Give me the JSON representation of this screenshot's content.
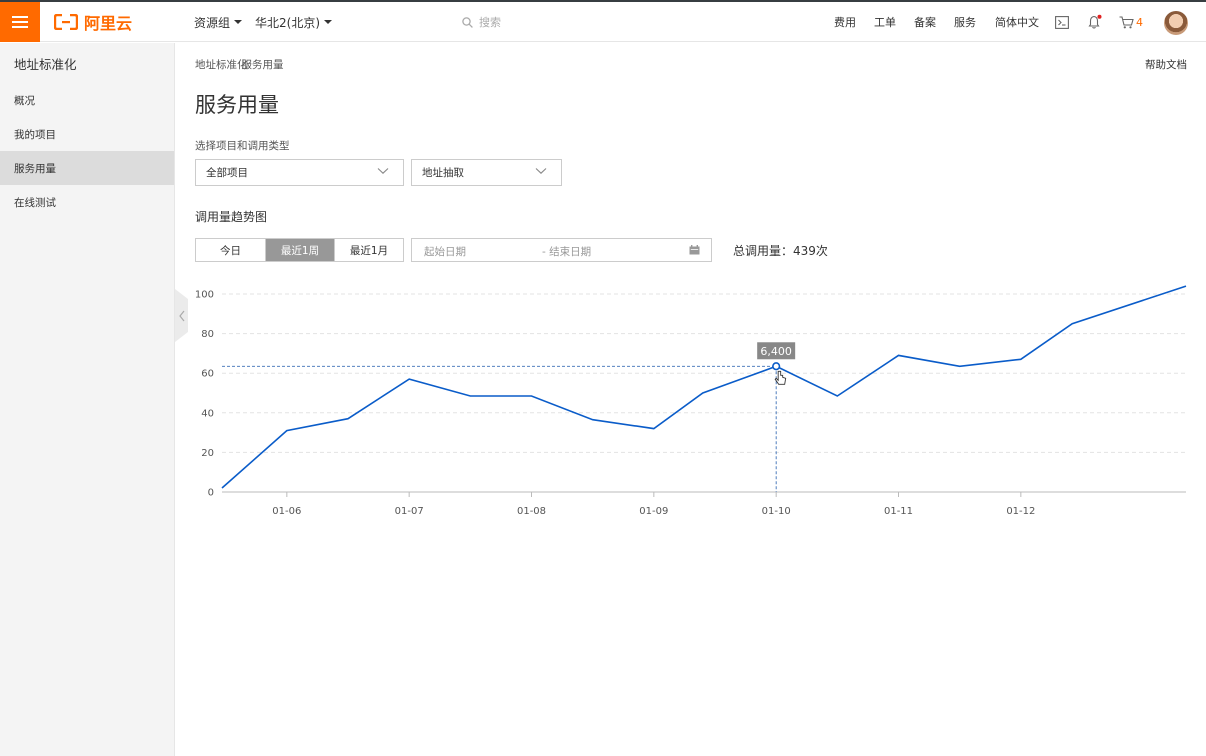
{
  "topbar": {
    "logo_text": "阿里云",
    "resource_group": "资源组",
    "region": "华北2(北京)",
    "search_placeholder": "搜索",
    "links": [
      "费用",
      "工单",
      "备案",
      "服务",
      "简体中文"
    ],
    "cart_count": "4"
  },
  "sidebar": {
    "title": "地址标准化",
    "items": [
      {
        "label": "概况",
        "active": false
      },
      {
        "label": "我的项目",
        "active": false
      },
      {
        "label": "服务用量",
        "active": true
      },
      {
        "label": "在线测试",
        "active": false
      }
    ]
  },
  "main": {
    "breadcrumb": "地址标准化",
    "breadcrumb_current": "服务用量",
    "help": "帮助文档",
    "title": "服务用量",
    "select_label": "选择项目和调用类型",
    "project_select": "全部项目",
    "type_select": "地址抽取",
    "section_title": "调用量趋势图",
    "ranges": [
      "今日",
      "最近1周",
      "最近1月"
    ],
    "active_range": 1,
    "date_start_placeholder": "起始日期",
    "date_end_placeholder": "- 结束日期",
    "total": "总调用量：439次"
  },
  "chart_data": {
    "type": "line",
    "x_ticks": [
      "01-06",
      "01-07",
      "01-08",
      "01-09",
      "01-10",
      "01-11",
      "01-12"
    ],
    "y_ticks": [
      0,
      20,
      40,
      60,
      80,
      100
    ],
    "ylim": [
      0,
      100
    ],
    "x": [
      5.47,
      6.0,
      6.5,
      7.0,
      7.5,
      8.0,
      8.5,
      9.0,
      9.4,
      10.0,
      10.5,
      11.0,
      11.5,
      12.0,
      12.42,
      13.35
    ],
    "values": [
      2,
      31,
      37,
      57,
      48.5,
      48.5,
      36.5,
      32,
      50,
      63.5,
      48.5,
      69,
      63.5,
      67,
      85,
      104
    ],
    "grid": true,
    "line_color": "#0a5cc9",
    "tooltip": {
      "x": 10.0,
      "label": "6,400"
    }
  }
}
